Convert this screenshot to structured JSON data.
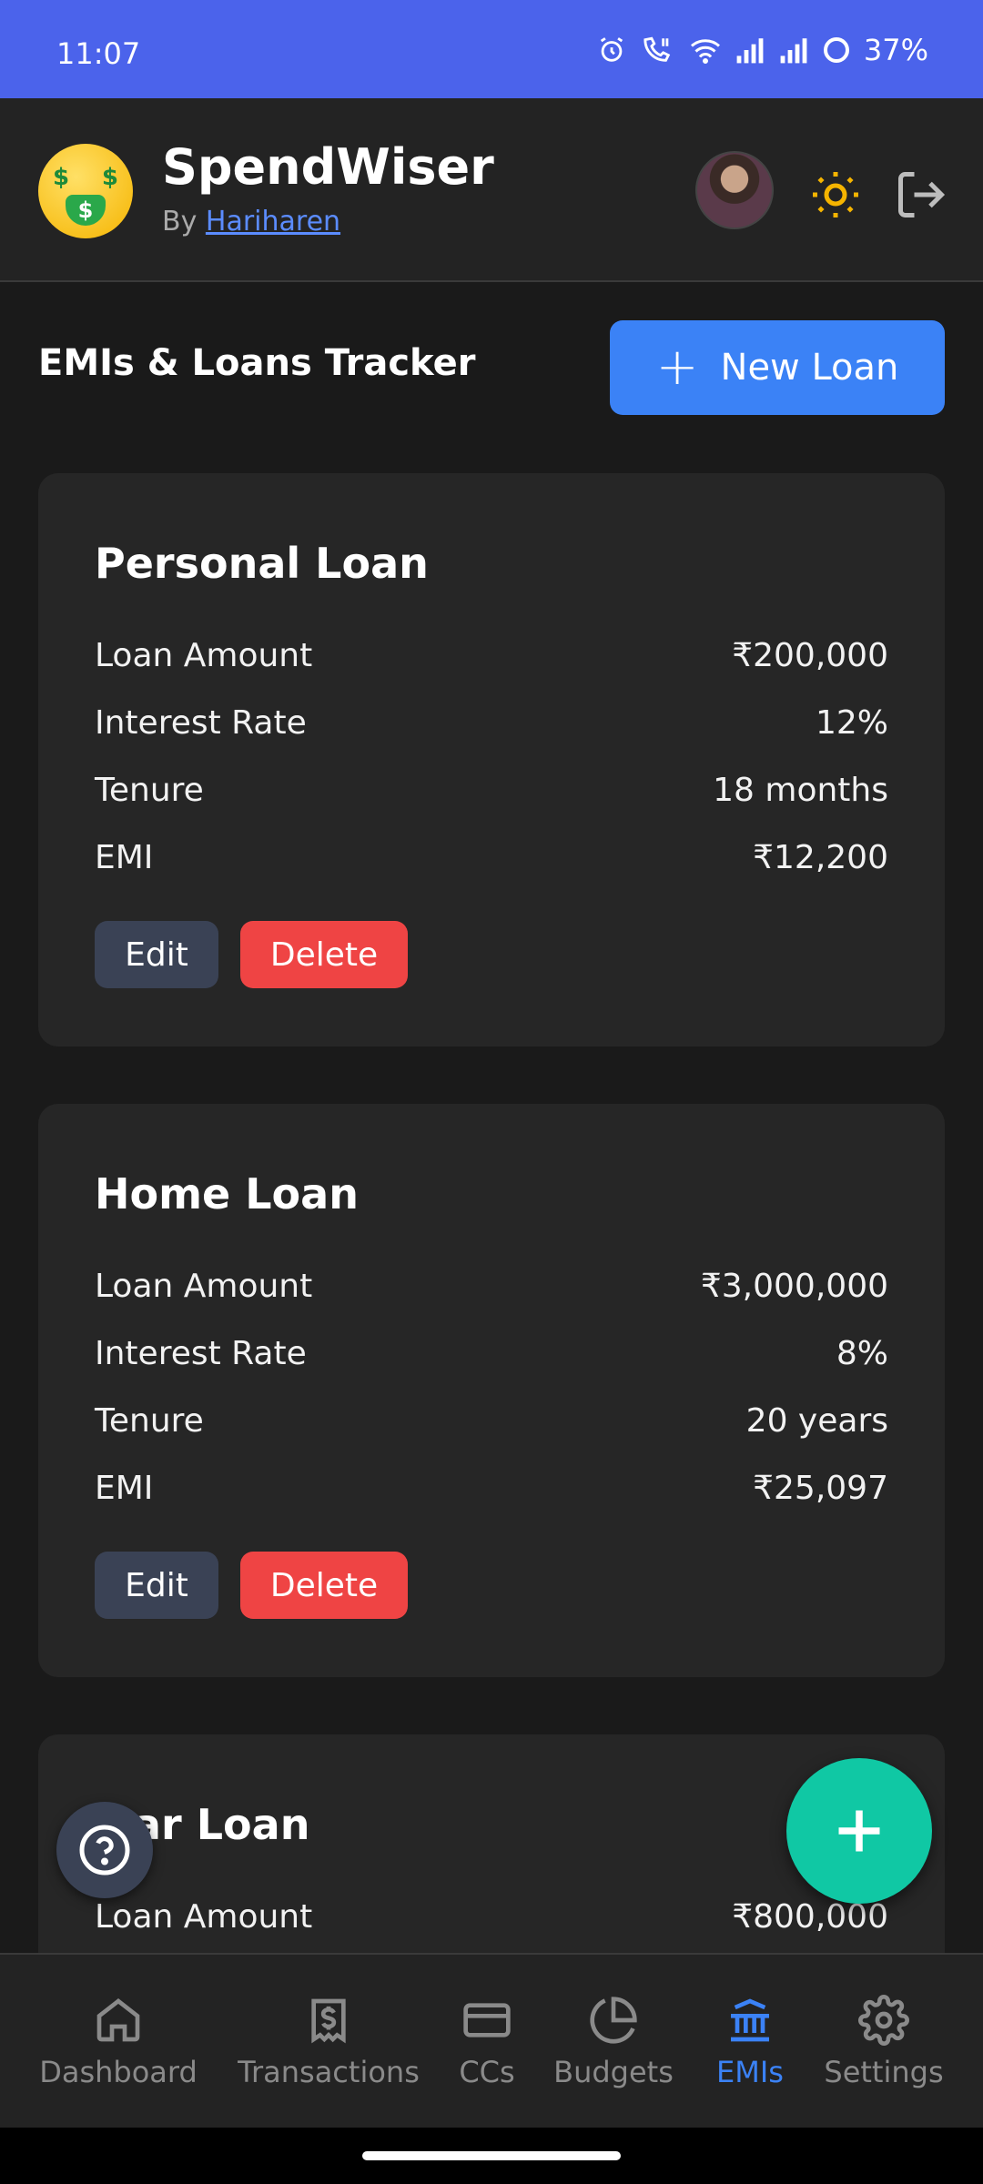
{
  "status_bar": {
    "time": "11:07",
    "battery": "37%"
  },
  "header": {
    "app_name": "SpendWiser",
    "by_prefix": "By",
    "author": "Hariharen",
    "theme_icon": "sun-icon",
    "logout_icon": "logout-icon"
  },
  "page": {
    "title": "EMIs & Loans Tracker",
    "new_loan_label": "New Loan"
  },
  "labels": {
    "loan_amount": "Loan Amount",
    "interest_rate": "Interest Rate",
    "tenure": "Tenure",
    "emi": "EMI",
    "edit": "Edit",
    "delete": "Delete"
  },
  "loans": [
    {
      "name": "Personal Loan",
      "amount": "₹200,000",
      "rate": "12%",
      "tenure": "18 months",
      "emi": "₹12,200"
    },
    {
      "name": "Home Loan",
      "amount": "₹3,000,000",
      "rate": "8%",
      "tenure": "20 years",
      "emi": "₹25,097"
    },
    {
      "name": "Car Loan",
      "visible_name": "ar Loan",
      "amount": "₹800,000"
    }
  ],
  "fab": {
    "help_icon": "question-circle-icon",
    "add_icon": "plus-icon"
  },
  "nav": {
    "items": [
      {
        "label": "Dashboard",
        "icon": "home-icon"
      },
      {
        "label": "Transactions",
        "icon": "receipt-icon"
      },
      {
        "label": "CCs",
        "icon": "credit-card-icon"
      },
      {
        "label": "Budgets",
        "icon": "pie-chart-icon"
      },
      {
        "label": "EMIs",
        "icon": "bank-icon",
        "active": true
      },
      {
        "label": "Settings",
        "icon": "gear-icon"
      }
    ]
  },
  "colors": {
    "status_bar": "#4b63eb",
    "primary": "#3b82f6",
    "danger": "#ef4444",
    "fab": "#10c8a4",
    "background": "#1a1a1a",
    "card": "#262626"
  }
}
